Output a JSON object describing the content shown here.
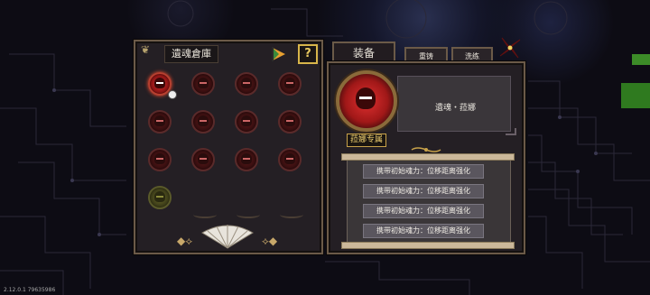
{
  "inventory": {
    "title": "遺魂倉庫",
    "help_label": "?",
    "slots": [
      {
        "state": "active",
        "badge": true
      },
      {
        "state": "normal"
      },
      {
        "state": "normal"
      },
      {
        "state": "normal"
      },
      {
        "state": "normal"
      },
      {
        "state": "normal"
      },
      {
        "state": "normal"
      },
      {
        "state": "normal"
      },
      {
        "state": "normal"
      },
      {
        "state": "normal"
      },
      {
        "state": "normal"
      },
      {
        "state": "normal"
      },
      {
        "state": "gold"
      }
    ]
  },
  "tabs": {
    "equip": "装备",
    "refine": "重铸",
    "wash": "洗练"
  },
  "equip": {
    "soul_name": "遺魂・菈娜",
    "exclusive_label": "菈娜专属",
    "effects": [
      "携带初始魂力：位移距离强化",
      "携带初始魂力：位移距离强化",
      "携带初始魂力：位移距离强化",
      "携带初始魂力：位移距离强化"
    ]
  },
  "version": "2.12.0.1 79635986",
  "colors": {
    "accent_gold": "#d8b54a",
    "soul_red": "#e23030",
    "panel_bg": "#241f24"
  },
  "icons": [
    "flag-icon",
    "help-icon",
    "close-icon",
    "fan-icon",
    "scroll-ornament-icon"
  ]
}
